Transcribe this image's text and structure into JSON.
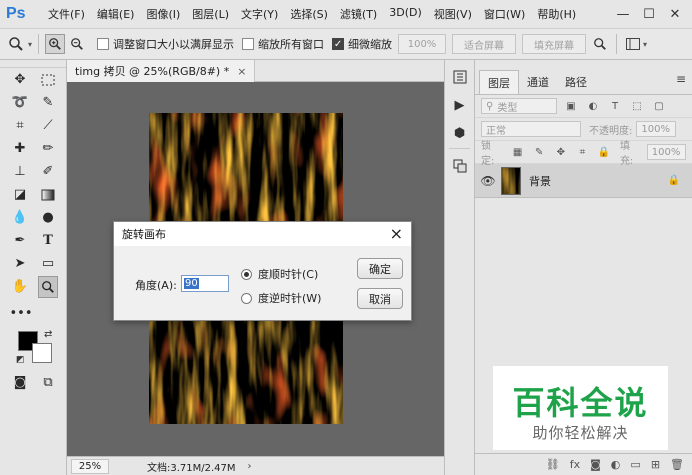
{
  "app": {
    "logo": "Ps"
  },
  "menu": [
    "文件(F)",
    "编辑(E)",
    "图像(I)",
    "图层(L)",
    "文字(Y)",
    "选择(S)",
    "滤镜(T)",
    "3D(D)",
    "视图(V)",
    "窗口(W)",
    "帮助(H)"
  ],
  "window_controls": {
    "minimize": "—",
    "maximize": "☐",
    "close": "✕"
  },
  "options": {
    "resize_windows": "调整窗口大小以满屏显示",
    "zoom_all_windows": "缩放所有窗口",
    "scrubby_zoom": "细微缩放",
    "zoom_100": "100%",
    "fit_screen": "适合屏幕",
    "fill_screen": "填充屏幕"
  },
  "document": {
    "tab_title": "timg 拷贝 @ 25%(RGB/8#) *",
    "close": "×",
    "zoom": "25%",
    "doc_info": "文档:3.71M/2.47M"
  },
  "panels": {
    "tabs": [
      "图层",
      "通道",
      "路径"
    ],
    "filter_kind": "类型",
    "blend_mode": "正常",
    "opacity_label": "不透明度:",
    "opacity_value": "100%",
    "lock_label": "锁定:",
    "fill_label": "填充:",
    "fill_value": "100%",
    "layer_name": "背景"
  },
  "dialog": {
    "title": "旋转画布",
    "angle_label": "角度(A):",
    "angle_value": "90",
    "radio_cw": "度顺时针(C)",
    "radio_ccw": "度逆时针(W)",
    "cw_selected": true,
    "ok": "确定",
    "cancel": "取消"
  },
  "watermark": {
    "title": "百科全说",
    "subtitle": "助你轻松解决"
  },
  "colors": {
    "watermark_green": "#1fa34a",
    "ps_blue": "#2b7bd6",
    "selection_blue": "#3a74c9"
  }
}
